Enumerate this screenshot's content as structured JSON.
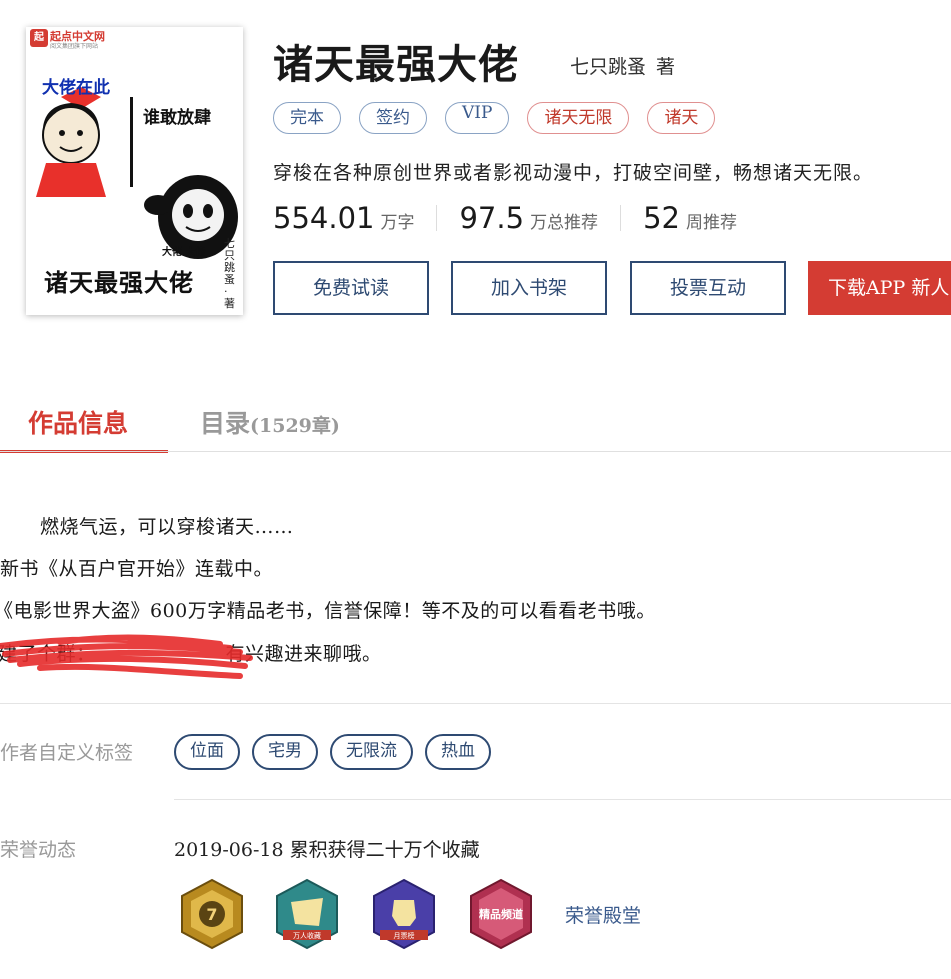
{
  "book": {
    "title": "诸天最强大佬",
    "author": "七只跳蚤",
    "author_suffix": "著",
    "tags": [
      {
        "label": "完本",
        "style": "blue"
      },
      {
        "label": "签约",
        "style": "blue"
      },
      {
        "label": "VIP",
        "style": "blue"
      },
      {
        "label": "诸天无限",
        "style": "red"
      },
      {
        "label": "诸天",
        "style": "red"
      }
    ],
    "intro": "穿梭在各种原创世界或者影视动漫中，打破空间壁，畅想诸天无限。",
    "stats": [
      {
        "value": "554.01",
        "unit": "万字"
      },
      {
        "value": "97.5",
        "unit": "万总推荐"
      },
      {
        "value": "52",
        "unit": "周推荐"
      }
    ]
  },
  "cover": {
    "site_name": "起点中文网",
    "site_sub": "阅文集团旗下网站",
    "logo_mark": "起点",
    "text_top": "大佬在此",
    "text_mid": "谁敢放肆",
    "text_small": "大佬 大佬",
    "text_bottom": "诸天最强大佬",
    "text_author": "七只跳蚤·著"
  },
  "actions": {
    "free_read": "免费试读",
    "add_shelf": "加入书架",
    "vote": "投票互动",
    "download": "下载APP  新人"
  },
  "tabs": {
    "info": "作品信息",
    "catalog": "目录",
    "catalog_count": "(1529章)"
  },
  "description": {
    "line1": "燃烧气运，可以穿梭诸天……",
    "line2": "新书《从百户官开始》连载中。",
    "line3": "《电影世界大盗》600万字精品老书，信誉保障！等不及的可以看看老书哦。",
    "line4_prefix": "建了个群：",
    "line4_suffix": "有兴趣进来聊哦。"
  },
  "custom_tags": {
    "label": "作者自定义标签",
    "items": [
      "位面",
      "宅男",
      "无限流",
      "热血"
    ]
  },
  "honors": {
    "label": "荣誉动态",
    "date": "2019-06-18",
    "text": "累积获得二十万个收藏",
    "badges": [
      {
        "icon": "rank-7-badge-icon",
        "color": "#b88a1f",
        "text": "7"
      },
      {
        "icon": "wanren-shoucang-badge-icon",
        "color": "#2f8a8a",
        "text": "万人收藏"
      },
      {
        "icon": "fist-badge-icon",
        "color": "#4a3fa8",
        "text": "月票榜"
      },
      {
        "icon": "jingpin-pindao-badge-icon",
        "color": "#b03050",
        "text": "精品频道"
      }
    ],
    "hall_link": "荣誉殿堂"
  },
  "colors": {
    "accent": "#d43c33",
    "navy": "#2e4a72"
  }
}
